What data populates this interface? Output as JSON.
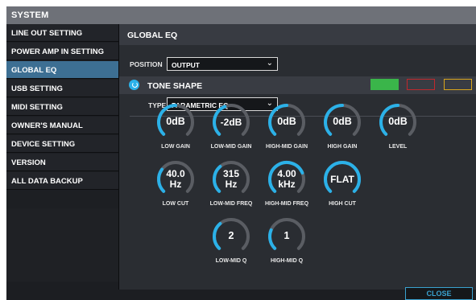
{
  "window": {
    "title": "SYSTEM"
  },
  "sidebar": {
    "items": [
      {
        "label": "LINE OUT SETTING"
      },
      {
        "label": "POWER AMP IN SETTING"
      },
      {
        "label": "GLOBAL EQ"
      },
      {
        "label": "USB SETTING"
      },
      {
        "label": "MIDI SETTING"
      },
      {
        "label": "OWNER'S MANUAL"
      },
      {
        "label": "DEVICE SETTING"
      },
      {
        "label": "VERSION"
      },
      {
        "label": "ALL DATA BACKUP"
      }
    ],
    "active_index": 2
  },
  "main": {
    "header": "GLOBAL EQ",
    "position": {
      "label": "POSITION",
      "value": "OUTPUT"
    },
    "tone_shape": {
      "title": "TONE SHAPE",
      "swatches": [
        {
          "name": "green",
          "color": "#3ab54a",
          "filled": true
        },
        {
          "name": "red",
          "color": "#c0282d",
          "filled": false
        },
        {
          "name": "yellow",
          "color": "#d9a51c",
          "filled": false
        }
      ]
    },
    "type": {
      "label": "TYPE",
      "value": "PARAMETRIC EQ"
    },
    "knobs": [
      {
        "id": "low-gain",
        "value": "0dB",
        "label": "LOW GAIN",
        "level": 0.5
      },
      {
        "id": "low-mid-gain",
        "value": "-2dB",
        "label": "LOW-MID GAIN",
        "level": 0.42
      },
      {
        "id": "high-mid-gain",
        "value": "0dB",
        "label": "HIGH-MID GAIN",
        "level": 0.5
      },
      {
        "id": "high-gain",
        "value": "0dB",
        "label": "HIGH GAIN",
        "level": 0.5
      },
      {
        "id": "level",
        "value": "0dB",
        "label": "LEVEL",
        "level": 0.5
      },
      {
        "id": "low-cut",
        "value": "40.0\nHz",
        "label": "LOW CUT",
        "level": 0.3
      },
      {
        "id": "low-mid-freq",
        "value": "315\nHz",
        "label": "LOW-MID FREQ",
        "level": 0.35
      },
      {
        "id": "high-mid-freq",
        "value": "4.00\nkHz",
        "label": "HIGH-MID FREQ",
        "level": 0.75
      },
      {
        "id": "high-cut",
        "value": "FLAT",
        "label": "HIGH CUT",
        "level": 1.0
      },
      {
        "id": "low-mid-q",
        "value": "2",
        "label": "LOW-MID Q",
        "level": 0.35
      },
      {
        "id": "high-mid-q",
        "value": "1",
        "label": "HIGH-MID Q",
        "level": 0.25
      }
    ]
  },
  "footer": {
    "close_label": "CLOSE"
  },
  "colors": {
    "accent": "#2bb1e8",
    "active_item": "#3d6f93",
    "knob_track": "#5a5d63"
  }
}
